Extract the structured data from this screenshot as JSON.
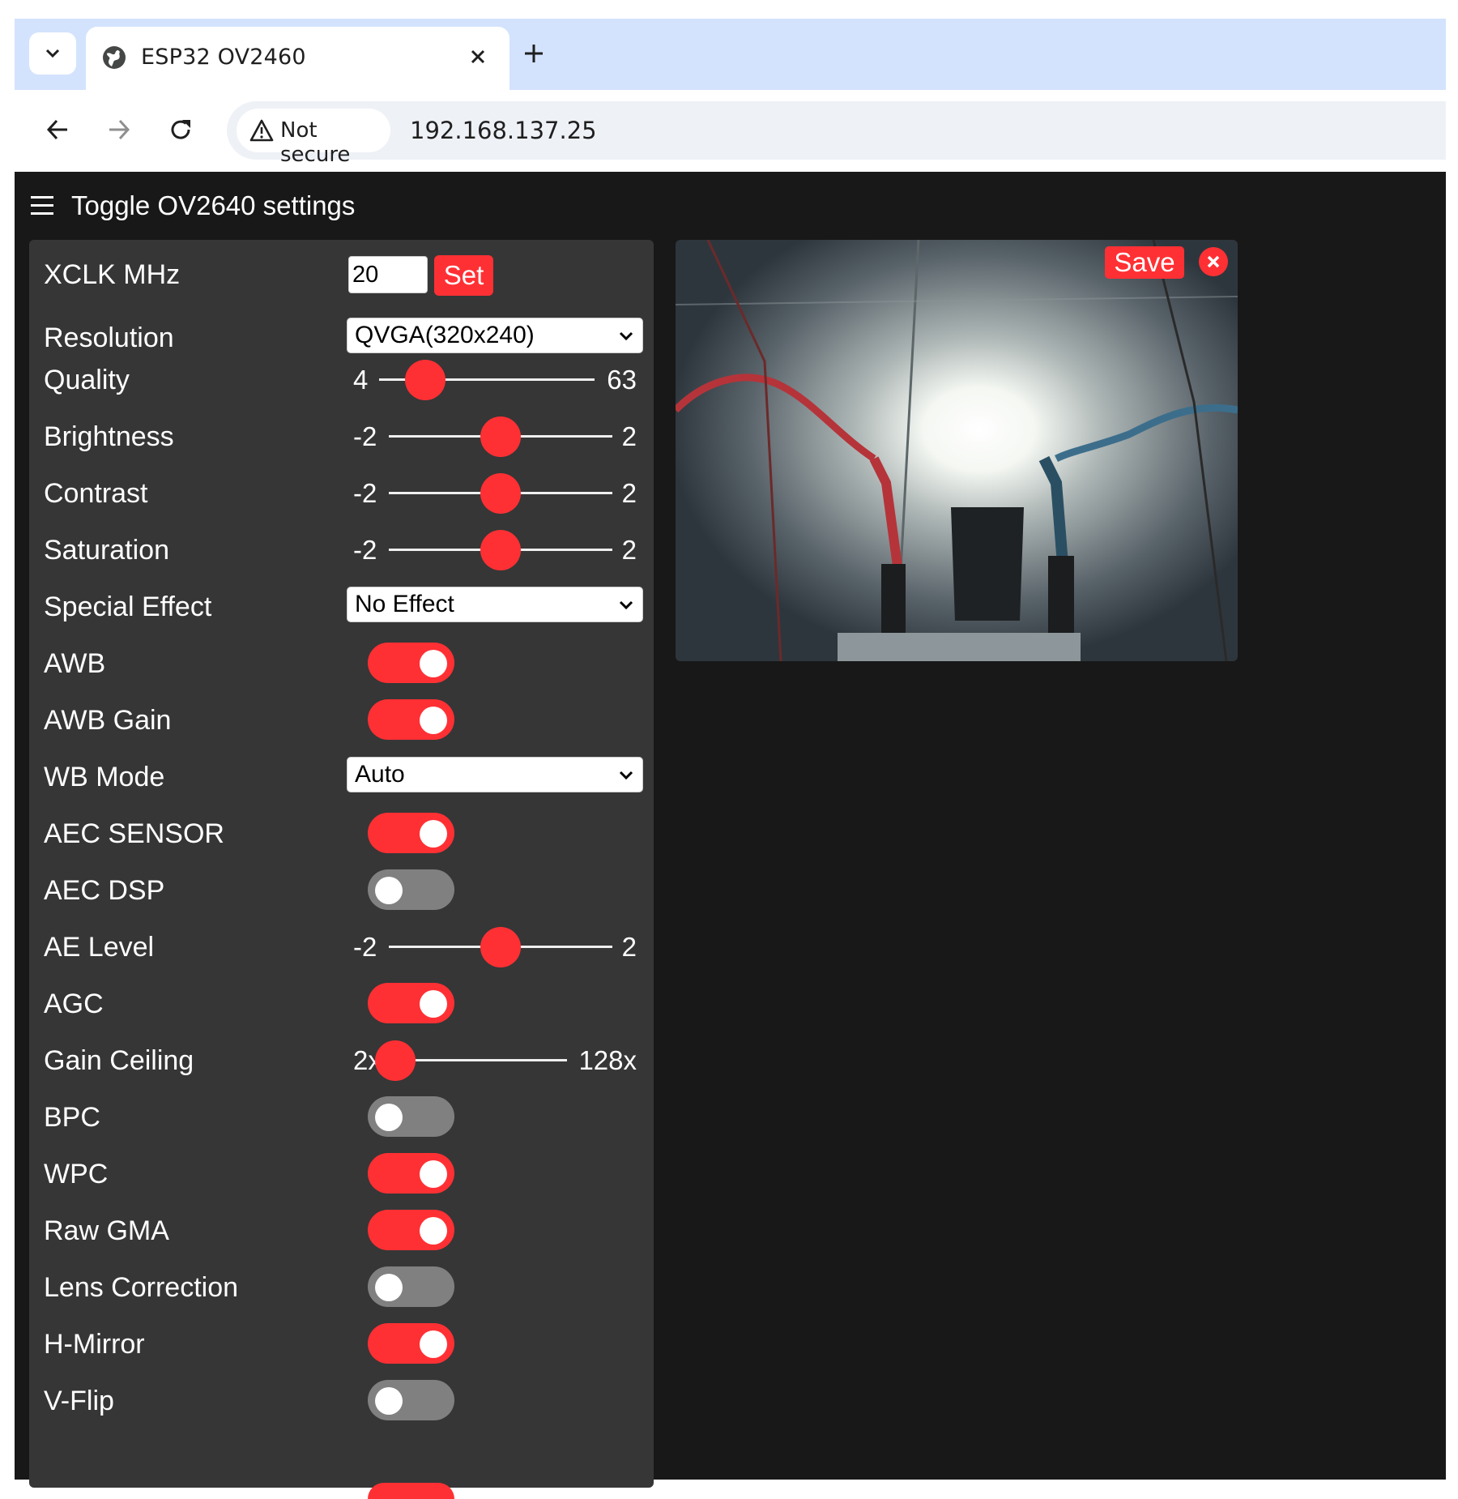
{
  "browser": {
    "tab_title": "ESP32 OV2460",
    "security_label": "Not secure",
    "url": "192.168.137.25"
  },
  "page": {
    "toggle_label": "Toggle OV2640 settings",
    "save_label": "Save"
  },
  "settings": {
    "xclk": {
      "label": "XCLK MHz",
      "value": "20",
      "button": "Set"
    },
    "resolution": {
      "label": "Resolution",
      "selected": "QVGA(320x240)"
    },
    "quality": {
      "label": "Quality",
      "min": "4",
      "max": "63",
      "value": 10
    },
    "brightness": {
      "label": "Brightness",
      "min": "-2",
      "max": "2",
      "value": 0
    },
    "contrast": {
      "label": "Contrast",
      "min": "-2",
      "max": "2",
      "value": 0
    },
    "saturation": {
      "label": "Saturation",
      "min": "-2",
      "max": "2",
      "value": 0
    },
    "special_effect": {
      "label": "Special Effect",
      "selected": "No Effect"
    },
    "awb": {
      "label": "AWB",
      "on": true
    },
    "awb_gain": {
      "label": "AWB Gain",
      "on": true
    },
    "wb_mode": {
      "label": "WB Mode",
      "selected": "Auto"
    },
    "aec_sensor": {
      "label": "AEC SENSOR",
      "on": true
    },
    "aec_dsp": {
      "label": "AEC DSP",
      "on": false
    },
    "ae_level": {
      "label": "AE Level",
      "min": "-2",
      "max": "2",
      "value": 0
    },
    "agc": {
      "label": "AGC",
      "on": true
    },
    "gain_ceiling": {
      "label": "Gain Ceiling",
      "min": "2x",
      "max": "128x",
      "value": 0
    },
    "bpc": {
      "label": "BPC",
      "on": false
    },
    "wpc": {
      "label": "WPC",
      "on": true
    },
    "raw_gma": {
      "label": "Raw GMA",
      "on": true
    },
    "lens_correction": {
      "label": "Lens Correction",
      "on": false
    },
    "h_mirror": {
      "label": "H-Mirror",
      "on": true
    },
    "v_flip": {
      "label": "V-Flip",
      "on": false
    }
  },
  "colors": {
    "accent": "#ff3034",
    "panel": "#363636",
    "page_bg": "#181818",
    "tabstrip": "#d3e3fd"
  },
  "icons": {
    "tab_menu": "chevron-down-icon",
    "tab_site": "globe-icon",
    "tab_close": "close-icon",
    "new_tab": "plus-icon",
    "back": "back-arrow-icon",
    "forward": "forward-arrow-icon",
    "reload": "reload-icon",
    "security": "warning-icon",
    "menu": "hamburger-icon",
    "stream_close": "close-icon"
  }
}
